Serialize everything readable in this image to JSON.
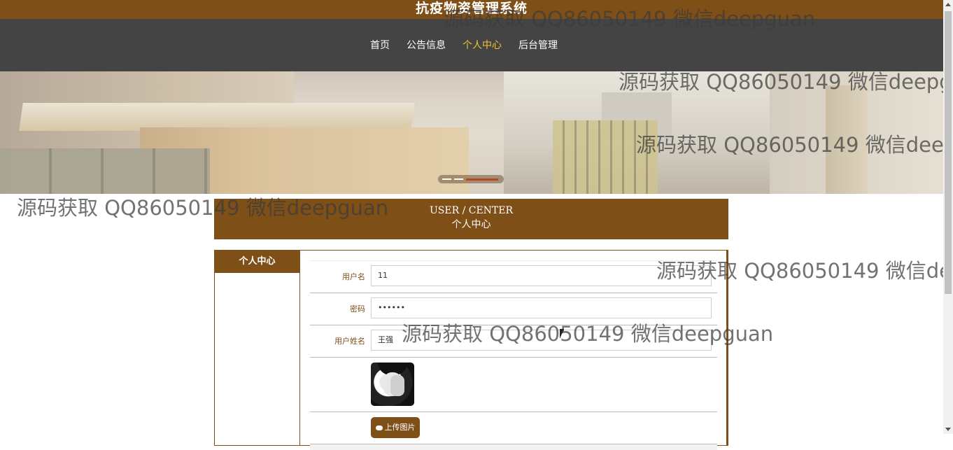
{
  "header": {
    "site_title": "抗疫物资管理系统",
    "nav": [
      {
        "label": "首页",
        "active": false
      },
      {
        "label": "公告信息",
        "active": false
      },
      {
        "label": "个人中心",
        "active": true
      },
      {
        "label": "后台管理",
        "active": false
      }
    ]
  },
  "banner": {
    "carousel_pages": 3,
    "active_page": 3
  },
  "section": {
    "title_en": "USER / CENTER",
    "title_cn": "个人中心"
  },
  "sidebar": {
    "title": "个人中心"
  },
  "form": {
    "username_label": "用户名",
    "username_value": "11",
    "password_label": "密码",
    "password_value": "••••••",
    "realname_label": "用户姓名",
    "realname_value": "王强",
    "upload_button": "上传图片"
  },
  "watermark": "源码获取 QQ86050149 微信deepguan",
  "colors": {
    "brand": "#7f4f18",
    "nav_bg": "#444444",
    "nav_active": "#f2c234"
  }
}
